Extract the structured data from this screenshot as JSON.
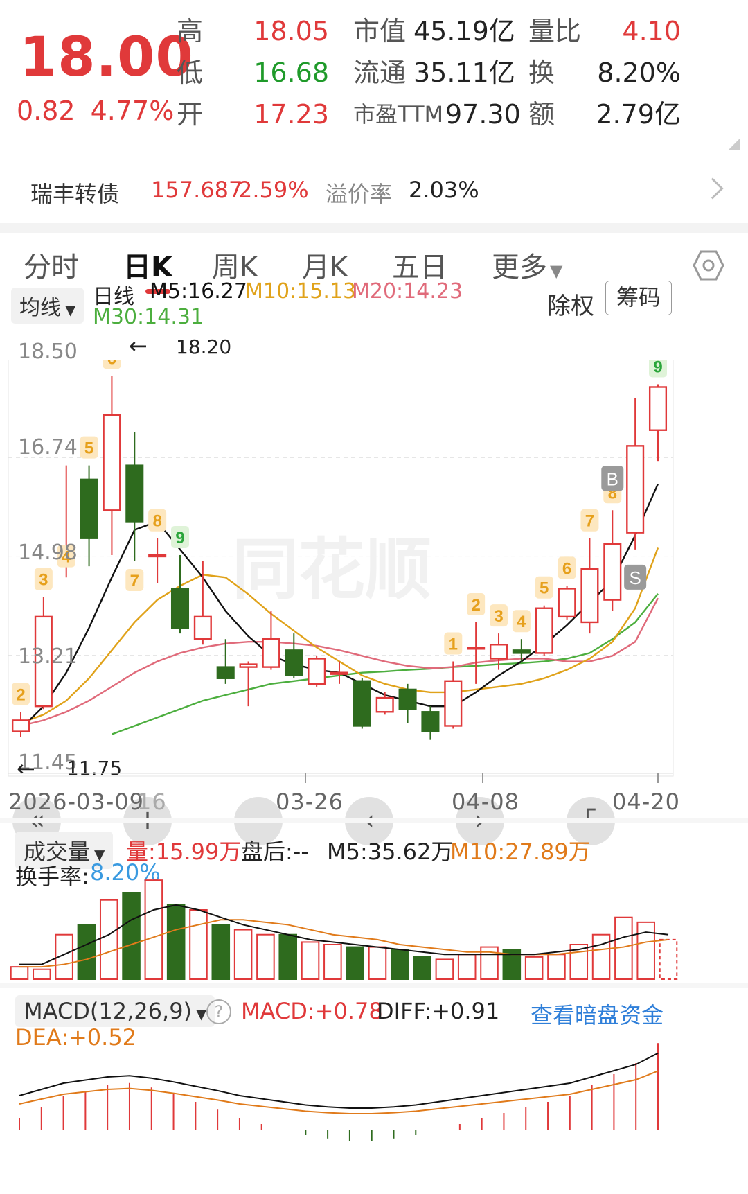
{
  "quote": {
    "price": "18.00",
    "change": "0.82",
    "change_pct": "4.77%",
    "rows": [
      {
        "l1": "高",
        "v1": "18.05",
        "l2": "市值",
        "v2": "45.19亿",
        "l3": "量比",
        "v3": "4.10"
      },
      {
        "l1": "低",
        "v1": "16.68",
        "l2": "流通",
        "v2": "35.11亿",
        "l3": "换",
        "v3": "8.20%"
      },
      {
        "l1": "开",
        "v1": "17.23",
        "l2": "市盈TTM",
        "v2": "97.30",
        "l3": "额",
        "v3": "2.79亿"
      }
    ]
  },
  "convertible": {
    "name": "瑞丰转债",
    "price": "157.687",
    "pct": "2.59%",
    "premium_label": "溢价率",
    "premium": "2.03%"
  },
  "tabs": [
    "分时",
    "日K",
    "周K",
    "月K",
    "五日",
    "更多"
  ],
  "active_tab": "日K",
  "ma_bar": {
    "selector": "均线",
    "period": "日线",
    "m5": "M5:16.27",
    "m10": "M10:15.13",
    "m20": "M20:14.23",
    "m30": "M30:14.31",
    "exright": "除权",
    "chips": "筹码"
  },
  "colors": {
    "up": "#e0393a",
    "down": "#2e6b1e",
    "m5": "#111111",
    "m10": "#e0a21a",
    "m20": "#e06a7a",
    "m30": "#4cae3e"
  },
  "kline": {
    "y_ticks": [
      "18.50",
      "16.74",
      "14.98",
      "13.21",
      "11.45"
    ],
    "high_mark": "18.20",
    "low_mark": "11.75",
    "x_ticks": [
      "2026-03-09",
      "16",
      "03-26",
      "04-08",
      "04-20"
    ]
  },
  "chart_data": {
    "type": "candlestick",
    "ylim": [
      11.3,
      18.6
    ],
    "candles": [
      {
        "o": 11.85,
        "c": 12.05,
        "h": 12.2,
        "l": 11.75
      },
      {
        "o": 12.3,
        "c": 13.9,
        "h": 14.25,
        "l": 12.25
      },
      {
        "o": 14.98,
        "c": 14.98,
        "h": 16.6,
        "l": 14.6
      },
      {
        "o": 16.35,
        "c": 15.3,
        "h": 16.6,
        "l": 14.8
      },
      {
        "o": 15.8,
        "c": 17.5,
        "h": 18.2,
        "l": 15.0
      },
      {
        "o": 16.6,
        "c": 15.6,
        "h": 17.2,
        "l": 14.9
      },
      {
        "o": 15.0,
        "c": 15.0,
        "h": 15.3,
        "l": 14.5
      },
      {
        "o": 14.4,
        "c": 13.7,
        "h": 15.0,
        "l": 13.6
      },
      {
        "o": 13.5,
        "c": 13.9,
        "h": 14.9,
        "l": 13.4
      },
      {
        "o": 13.0,
        "c": 12.8,
        "h": 13.5,
        "l": 12.7
      },
      {
        "o": 13.0,
        "c": 13.05,
        "h": 13.1,
        "l": 12.3
      },
      {
        "o": 13.0,
        "c": 13.5,
        "h": 14.0,
        "l": 12.95
      },
      {
        "o": 13.3,
        "c": 12.85,
        "h": 13.6,
        "l": 12.8
      },
      {
        "o": 12.7,
        "c": 13.15,
        "h": 13.2,
        "l": 12.65
      },
      {
        "o": 12.9,
        "c": 12.9,
        "h": 13.1,
        "l": 12.7
      },
      {
        "o": 12.75,
        "c": 11.95,
        "h": 12.8,
        "l": 11.9
      },
      {
        "o": 12.2,
        "c": 12.45,
        "h": 12.55,
        "l": 12.15
      },
      {
        "o": 12.6,
        "c": 12.25,
        "h": 12.7,
        "l": 12.0
      },
      {
        "o": 12.2,
        "c": 11.85,
        "h": 12.3,
        "l": 11.7
      },
      {
        "o": 11.95,
        "c": 12.75,
        "h": 13.1,
        "l": 11.9
      },
      {
        "o": 13.35,
        "c": 13.35,
        "h": 13.8,
        "l": 12.7
      },
      {
        "o": 13.15,
        "c": 13.4,
        "h": 13.6,
        "l": 12.95
      },
      {
        "o": 13.3,
        "c": 13.25,
        "h": 13.5,
        "l": 13.1
      },
      {
        "o": 13.25,
        "c": 14.05,
        "h": 14.1,
        "l": 13.2
      },
      {
        "o": 13.9,
        "c": 14.4,
        "h": 14.45,
        "l": 13.85
      },
      {
        "o": 13.8,
        "c": 14.75,
        "h": 15.3,
        "l": 13.6
      },
      {
        "o": 14.2,
        "c": 15.2,
        "h": 15.8,
        "l": 14.0
      },
      {
        "o": 15.4,
        "c": 16.95,
        "h": 17.8,
        "l": 15.1
      },
      {
        "o": 17.23,
        "c": 18.0,
        "h": 18.05,
        "l": 16.68
      }
    ],
    "ma5": [
      11.9,
      12.3,
      12.9,
      13.7,
      14.6,
      15.45,
      15.6,
      15.1,
      14.6,
      14.0,
      13.55,
      13.2,
      13.05,
      12.95,
      12.9,
      12.7,
      12.5,
      12.4,
      12.3,
      12.3,
      12.55,
      12.85,
      13.1,
      13.4,
      13.75,
      14.15,
      14.55,
      15.35,
      16.27
    ],
    "ma10": [
      12.0,
      12.15,
      12.4,
      12.8,
      13.3,
      13.8,
      14.2,
      14.45,
      14.65,
      14.6,
      14.3,
      13.95,
      13.65,
      13.35,
      13.1,
      12.85,
      12.7,
      12.6,
      12.55,
      12.55,
      12.6,
      12.65,
      12.7,
      12.8,
      12.95,
      13.15,
      13.45,
      14.05,
      15.13
    ],
    "ma20": [
      11.95,
      12.05,
      12.2,
      12.4,
      12.65,
      12.9,
      13.1,
      13.25,
      13.35,
      13.42,
      13.45,
      13.45,
      13.42,
      13.38,
      13.3,
      13.2,
      13.1,
      13.02,
      12.98,
      13.0,
      13.08,
      13.12,
      13.15,
      13.15,
      13.1,
      13.1,
      13.2,
      13.45,
      14.23
    ],
    "ma30": [
      null,
      null,
      null,
      null,
      11.8,
      11.95,
      12.1,
      12.25,
      12.4,
      12.5,
      12.6,
      12.7,
      12.75,
      12.8,
      12.85,
      12.9,
      12.92,
      12.95,
      12.97,
      13.0,
      13.02,
      13.05,
      13.07,
      13.1,
      13.15,
      13.25,
      13.5,
      13.8,
      14.31
    ],
    "td_labels": [
      {
        "i": 0,
        "t": "2",
        "c": "o",
        "pos": "top"
      },
      {
        "i": 1,
        "t": "3",
        "c": "o",
        "pos": "top"
      },
      {
        "i": 2,
        "t": "4",
        "c": "o",
        "pos": "mid"
      },
      {
        "i": 3,
        "t": "5",
        "c": "o",
        "pos": "top"
      },
      {
        "i": 4,
        "t": "6",
        "c": "o",
        "pos": "top"
      },
      {
        "i": 5,
        "t": "7",
        "c": "o",
        "pos": "bot"
      },
      {
        "i": 6,
        "t": "8",
        "c": "o",
        "pos": "top"
      },
      {
        "i": 7,
        "t": "9",
        "c": "g",
        "pos": "top"
      },
      {
        "i": 19,
        "t": "1",
        "c": "o",
        "pos": "top"
      },
      {
        "i": 20,
        "t": "2",
        "c": "o",
        "pos": "top"
      },
      {
        "i": 21,
        "t": "3",
        "c": "o",
        "pos": "top"
      },
      {
        "i": 22,
        "t": "4",
        "c": "o",
        "pos": "top"
      },
      {
        "i": 23,
        "t": "5",
        "c": "o",
        "pos": "top"
      },
      {
        "i": 24,
        "t": "6",
        "c": "o",
        "pos": "top"
      },
      {
        "i": 25,
        "t": "7",
        "c": "o",
        "pos": "top"
      },
      {
        "i": 26,
        "t": "8",
        "c": "o",
        "pos": "top"
      },
      {
        "i": 28,
        "t": "9",
        "c": "g",
        "pos": "top"
      }
    ],
    "signals": [
      {
        "i": 26,
        "t": "B"
      },
      {
        "i": 27,
        "t": "S"
      }
    ],
    "volume": [
      5,
      4,
      18,
      22,
      32,
      35,
      40,
      30,
      28,
      22,
      20,
      18,
      18,
      15,
      14,
      13,
      13,
      12,
      9,
      8,
      10,
      13,
      12,
      9,
      10,
      14,
      18,
      25,
      23,
      15.99
    ],
    "vol_ma5": [
      6,
      6,
      10,
      14,
      18,
      24,
      28,
      30,
      28,
      25,
      22,
      20,
      18,
      16,
      15,
      14,
      13,
      12,
      11,
      10,
      10,
      10,
      10,
      10,
      11,
      12,
      14,
      17,
      19,
      18
    ],
    "vol_ma10": [
      5,
      5,
      6,
      8,
      11,
      14,
      17,
      20,
      22,
      24,
      24,
      23,
      22,
      20,
      18,
      17,
      16,
      14,
      13,
      12,
      11,
      11,
      10,
      10,
      10,
      11,
      12,
      13,
      15,
      16
    ],
    "macd_bars": [
      0.1,
      0.2,
      0.3,
      0.35,
      0.4,
      0.42,
      0.38,
      0.32,
      0.25,
      0.18,
      0.1,
      0.05,
      0.0,
      -0.05,
      -0.08,
      -0.1,
      -0.1,
      -0.08,
      -0.05,
      0.0,
      0.05,
      0.1,
      0.15,
      0.2,
      0.25,
      0.3,
      0.4,
      0.5,
      0.6,
      0.78
    ]
  },
  "volume_bar": {
    "selector": "成交量",
    "vol": "量:15.99万",
    "after": "盘后:--",
    "m5": "M5:35.62万",
    "m10": "M10:27.89万",
    "turnover_label": "换手率:",
    "turnover": "8.20%"
  },
  "macd_bar": {
    "selector": "MACD(12,26,9)",
    "macd": "MACD:+0.78",
    "diff": "DIFF:+0.91",
    "dea": "DEA:+0.52",
    "link": "查看暗盘资金"
  }
}
